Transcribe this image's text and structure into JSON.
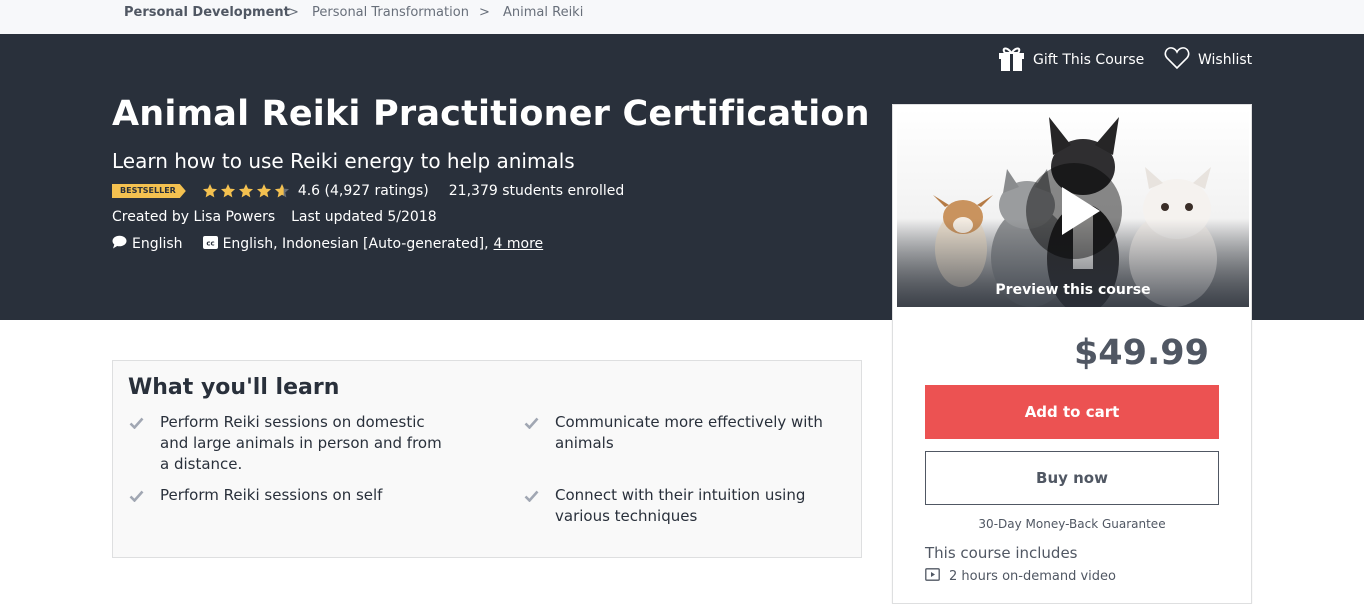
{
  "breadcrumb": [
    "Personal Development",
    "Personal Transformation",
    "Animal Reiki"
  ],
  "breadcrumb_separator": ">",
  "actions": {
    "gift": "Gift This Course",
    "wishlist": "Wishlist"
  },
  "course": {
    "title": "Animal Reiki Practitioner Certification",
    "subtitle": "Learn how to use Reiki energy to help animals",
    "badge": "BESTSELLER",
    "rating_text": "4.6 (4,927 ratings)",
    "rating_value": 4.6,
    "enrolled": "21,379 students enrolled",
    "created_by": "Created by Lisa Powers",
    "last_updated": "Last updated 5/2018",
    "language": "English",
    "captions": "English, Indonesian [Auto-generated],",
    "captions_more": "4 more"
  },
  "sidebar": {
    "preview_label": "Preview this course",
    "price": "$49.99",
    "add_to_cart": "Add to cart",
    "buy_now": "Buy now",
    "guarantee": "30-Day Money-Back Guarantee",
    "includes_title": "This course includes",
    "includes": [
      "2 hours on-demand video"
    ]
  },
  "learn": {
    "title": "What you'll learn",
    "items": [
      "Perform Reiki sessions on domestic and large animals in person and from a distance.",
      "Communicate more effectively with animals",
      "Perform Reiki sessions on self",
      "Connect with their intuition using various techniques"
    ]
  },
  "colors": {
    "hero_bg": "#29303b",
    "cta_red": "#ec5252",
    "star": "#f4c150",
    "badge": "#f4c150"
  }
}
